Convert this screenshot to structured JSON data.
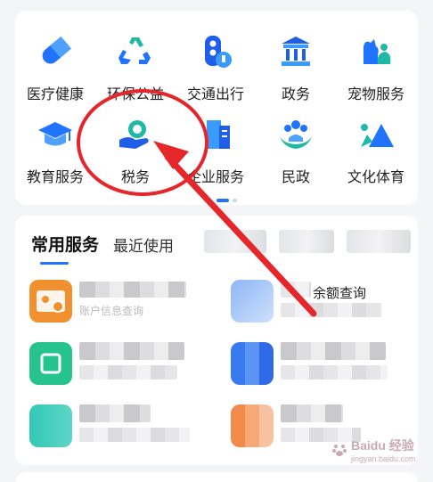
{
  "grid": {
    "items": [
      {
        "label": "医疗健康",
        "icon": "medical-capsule-icon"
      },
      {
        "label": "环保公益",
        "icon": "recycle-icon"
      },
      {
        "label": "交通出行",
        "icon": "traffic-light-icon"
      },
      {
        "label": "政务",
        "icon": "government-building-icon"
      },
      {
        "label": "宠物服务",
        "icon": "pet-icon"
      },
      {
        "label": "教育服务",
        "icon": "graduation-cap-icon"
      },
      {
        "label": "税务",
        "icon": "tax-hand-icon"
      },
      {
        "label": "企业服务",
        "icon": "office-building-icon"
      },
      {
        "label": "民政",
        "icon": "people-care-icon"
      },
      {
        "label": "文化体育",
        "icon": "culture-sports-icon"
      }
    ],
    "page_indicator": {
      "pages": 2,
      "current": 1
    }
  },
  "services": {
    "tabs": [
      {
        "label": "常用服务",
        "active": true
      },
      {
        "label": "最近使用",
        "active": false
      }
    ],
    "items": [
      {
        "name": "",
        "desc": "账户信息查询",
        "icon_color": "#f0902e"
      },
      {
        "name": "余额查询",
        "desc": "",
        "icon_color": "#6f9ff0"
      },
      {
        "name": "",
        "desc": "",
        "icon_color": "#27c38e"
      },
      {
        "name": "",
        "desc": "",
        "icon_color": "#3a7af0"
      },
      {
        "name": "",
        "desc": "",
        "icon_color": "#33c7b5"
      },
      {
        "name": "",
        "desc": "",
        "icon_color": "#f28a4a"
      }
    ]
  },
  "watermark": {
    "text": "Baidu 经验",
    "sub": "jingyan.baidu.com"
  },
  "colors": {
    "accent": "#1f73ff",
    "annotation": "#e5262b"
  }
}
